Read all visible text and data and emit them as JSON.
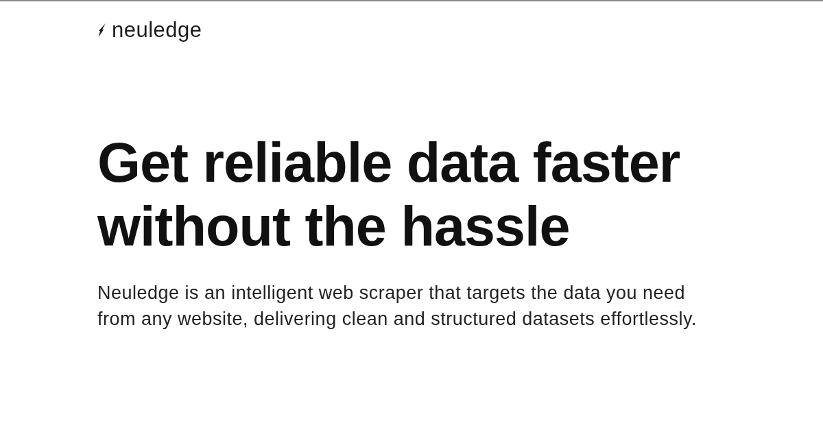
{
  "header": {
    "logo_text": "neuledge"
  },
  "hero": {
    "heading_lines": [
      "Get reliable data faster",
      "without the hassle"
    ],
    "description": "Neuledge is an intelligent web scraper that targets the data you need from any website, delivering clean and structured datasets effortlessly."
  }
}
